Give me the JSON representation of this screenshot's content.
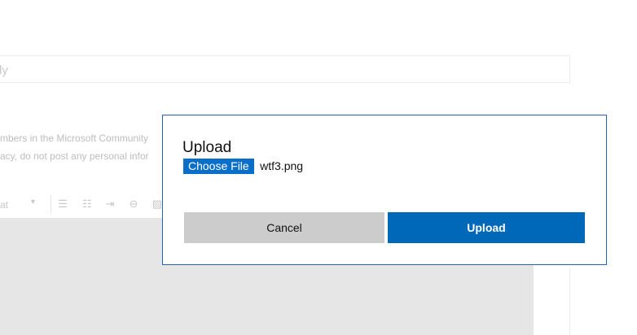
{
  "background": {
    "reply_placeholder": "ly",
    "notice_line1": "mbers in the Microsoft Community",
    "notice_line2": "acy, do not post any personal infor",
    "toolbar_format_label": "at",
    "toolbar_caret": "▾"
  },
  "dialog": {
    "title": "Upload",
    "choose_file_label": "Choose File",
    "file_name": "wtf3.png",
    "cancel_label": "Cancel",
    "upload_label": "Upload"
  },
  "colors": {
    "accent": "#0068b8",
    "choose_file": "#0a6fc9",
    "cancel_bg": "#cccccc",
    "dialog_border": "#1a66b8",
    "editor_bg": "#e6e6e6"
  }
}
